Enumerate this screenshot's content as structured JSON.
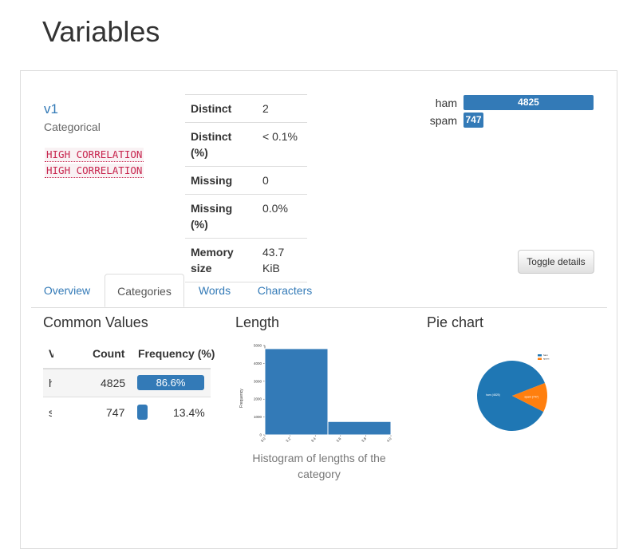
{
  "page": {
    "title": "Variables"
  },
  "variable": {
    "name": "v1",
    "type": "Categorical",
    "alerts": [
      "HIGH CORRELATION",
      "HIGH CORRELATION"
    ]
  },
  "stats": [
    {
      "label": "Distinct",
      "value": "2"
    },
    {
      "label": "Distinct (%)",
      "value": "< 0.1%"
    },
    {
      "label": "Missing",
      "value": "0"
    },
    {
      "label": "Missing (%)",
      "value": "0.0%"
    },
    {
      "label": "Memory size",
      "value": "43.7 KiB"
    }
  ],
  "mini_chart": {
    "items": [
      {
        "label": "ham",
        "value": "4825",
        "fraction": 1.0
      },
      {
        "label": "spam",
        "value": "747",
        "fraction": 0.155
      }
    ]
  },
  "toggle_label": "Toggle details",
  "tabs": [
    {
      "label": "Overview",
      "active": false
    },
    {
      "label": "Categories",
      "active": true
    },
    {
      "label": "Words",
      "active": false
    },
    {
      "label": "Characters",
      "active": false
    }
  ],
  "common_values": {
    "title": "Common Values",
    "headers": {
      "value": "V",
      "count": "Count",
      "frequency": "Frequency (%)"
    },
    "rows": [
      {
        "value": "h",
        "count": "4825",
        "freq": "86.6%",
        "fraction": 0.866
      },
      {
        "value": "s",
        "count": "747",
        "freq": "13.4%",
        "fraction": 0.134
      }
    ]
  },
  "length": {
    "title": "Length",
    "caption": "Histogram of lengths of the category"
  },
  "pie": {
    "title": "Pie chart"
  },
  "colors": {
    "primary": "#337ab7",
    "orange": "#ff7f0e",
    "link": "#337ab7"
  },
  "chart_data": [
    {
      "type": "bar",
      "title": "",
      "xlabel": "",
      "ylabel": "Frequency",
      "bins": [
        [
          3.0,
          3.5
        ],
        [
          3.5,
          4.0
        ]
      ],
      "values": [
        4825,
        747
      ],
      "xticks": [
        "3.0",
        "3.2",
        "3.4",
        "3.6",
        "3.8",
        "4.0"
      ],
      "yticks": [
        "0",
        "1000",
        "2000",
        "3000",
        "4000",
        "5000"
      ],
      "ylim": [
        0,
        5000
      ],
      "xlim": [
        3.0,
        4.0
      ]
    },
    {
      "type": "pie",
      "categories": [
        "ham",
        "spam"
      ],
      "values": [
        4825,
        747
      ],
      "labels": [
        "ham (4825)",
        "spam (747)"
      ],
      "colors": [
        "#1f77b4",
        "#ff7f0e"
      ],
      "legend_position": "top-right"
    }
  ]
}
